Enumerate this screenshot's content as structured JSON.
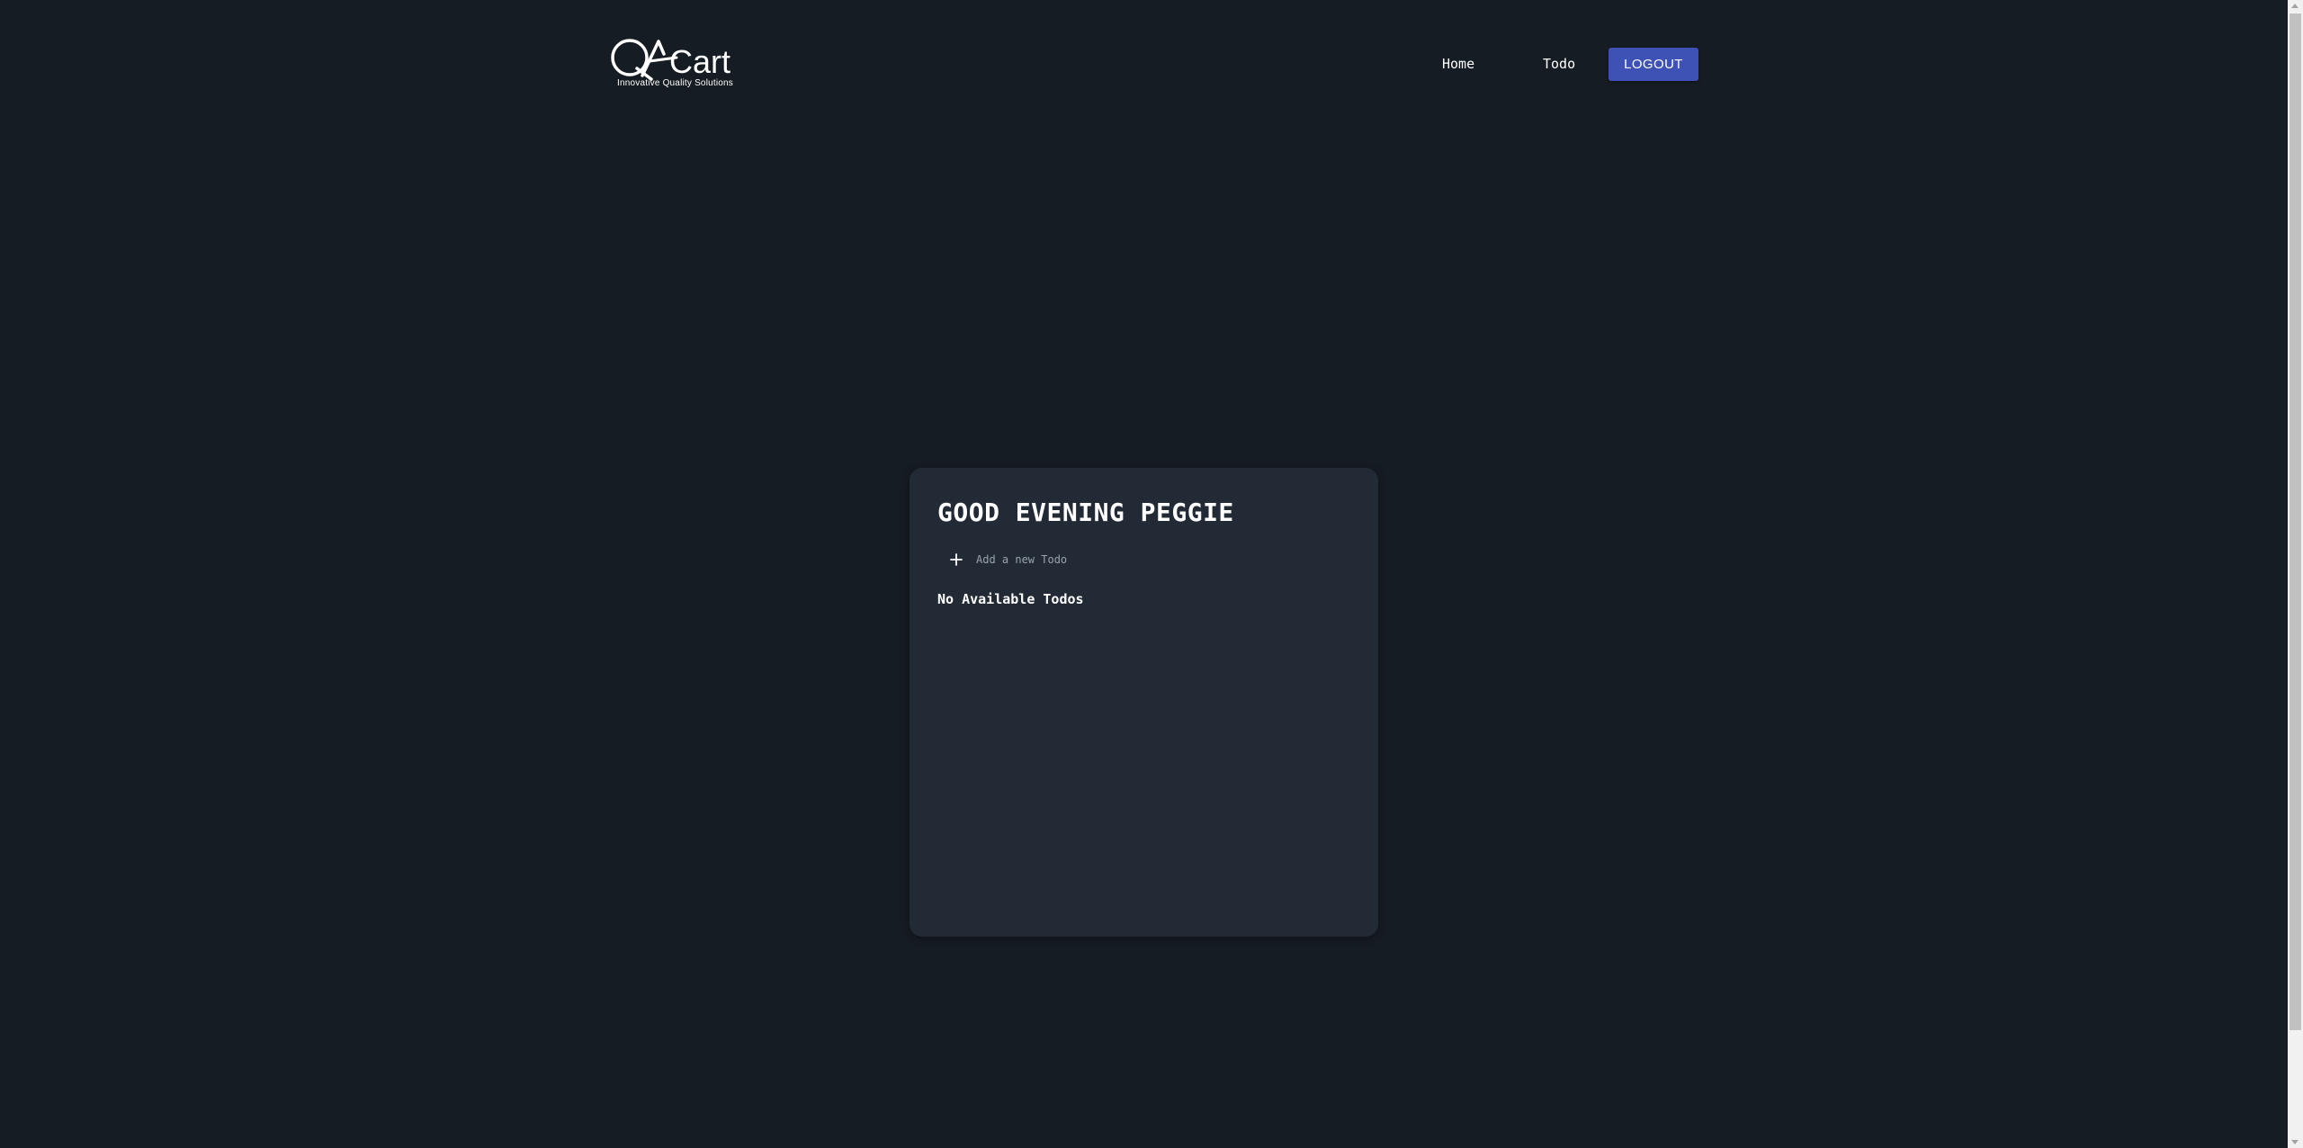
{
  "header": {
    "logo": {
      "text": "QACart",
      "tagline": "Innovative Quality Solutions"
    },
    "nav": {
      "home_label": "Home",
      "todo_label": "Todo",
      "logout_label": "LOGOUT"
    }
  },
  "main": {
    "greeting": "GOOD EVENING PEGGIE",
    "add_todo": {
      "icon": "plus-icon",
      "placeholder": "Add a new Todo",
      "value": ""
    },
    "empty_message": "No Available Todos"
  },
  "colors": {
    "background": "#161c23",
    "card": "#222b35",
    "accent": "#3e51b5",
    "text": "#ffffff",
    "placeholder": "#9aa3ad"
  }
}
